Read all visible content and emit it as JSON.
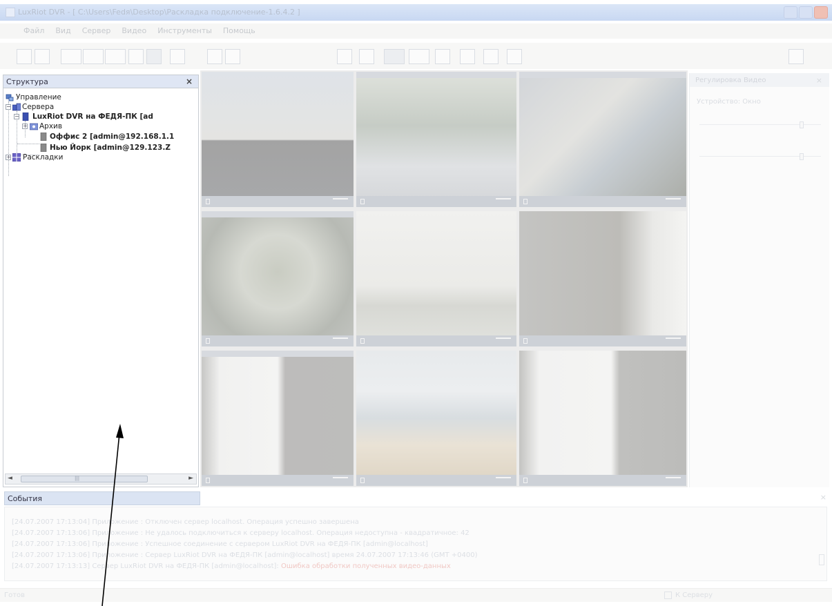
{
  "window": {
    "title": "LuxRiot DVR - [ C:\\Users\\Fedя\\Desktop\\Раскладка подключение-1.6.4.2 ]"
  },
  "menu": {
    "items": [
      "Файл",
      "Вид",
      "Сервер",
      "Видео",
      "Инструменты",
      "Помощь"
    ]
  },
  "structure_panel": {
    "title": "Структура",
    "close_glyph": "×",
    "tree": {
      "root_label": "Управление",
      "servers_label": "Сервера",
      "server1_label": "LuxRiot DVR на ФЕДЯ-ПК [ad",
      "archive_label": "Архив",
      "server2_label": "Оффис 2 [admin@192.168.1.1",
      "server3_label": "Нью Йорк [admin@129.123.Z",
      "layouts_label": "Раскладки"
    },
    "scroll_left_glyph": "◄",
    "scroll_right_glyph": "►",
    "grip_glyph": "|||"
  },
  "settings_panel": {
    "title": "Регулировка Видео",
    "subtitle": "Устройство: Окно",
    "close_glyph": "×",
    "sliders": [
      {
        "name": "brightness",
        "value": 0.85
      },
      {
        "name": "contrast",
        "value": 0.85
      }
    ]
  },
  "events_panel": {
    "title": "События",
    "close_glyph": "×",
    "lines": [
      {
        "text": "[24.07.2007 17:13:04] Приложение : Отключен сервер localhost. Операция успешно завершена"
      },
      {
        "text": "[24.07.2007 17:13:06] Приложение : Не удалось подключиться к серверу localhost. Операция недоступна - квадратичное: 42"
      },
      {
        "text": "[24.07.2007 17:13:06] Приложение : Успешное соединение с сервером LuxRiot DVR на ФЕДЯ-ПК [admin@localhost]"
      },
      {
        "text": "[24.07.2007 17:13:06] Приложение : Сервер LuxRiot DVR на ФЕДЯ-ПК [admin@localhost] время 24.07.2007 17:13:46 (GMT +0400)"
      },
      {
        "text": "[24.07.2007 17:13:13] Сервер LuxRiot DVR на ФЕДЯ-ПК [admin@localhost]: ",
        "red": "Ошибка обработки полученных видео-данных"
      }
    ]
  },
  "status_bar": {
    "left": "Готов",
    "right": "К Серверу"
  },
  "colors": {
    "panel_head": "#dfe6f4",
    "tree_server_icon": "#3a4fb0",
    "tree_offline_icon": "#888888"
  }
}
